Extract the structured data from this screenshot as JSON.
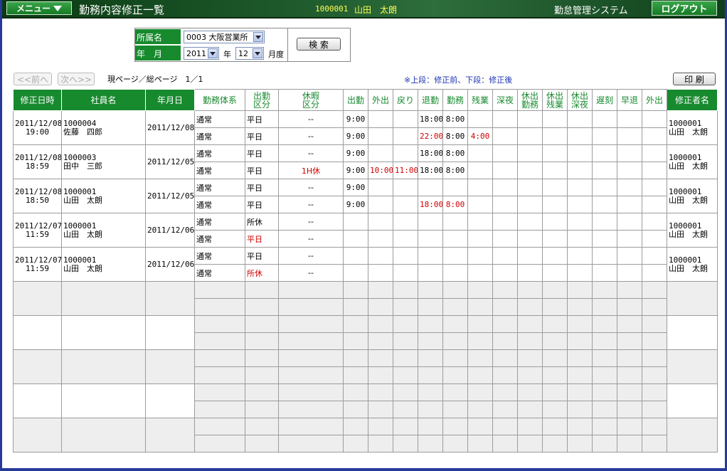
{
  "header": {
    "menu_label": "メニュー",
    "title": "勤務内容修正一覧",
    "user_code": "1000001",
    "user_name": "山田　太朗",
    "system_name": "勤怠管理システム",
    "logout_label": "ログアウト"
  },
  "filter": {
    "dept_label": "所属名",
    "dept_value": "0003 大阪営業所",
    "ym_label": "年　月",
    "year_value": "2011",
    "year_unit": "年",
    "month_value": "12",
    "month_unit": "月度",
    "search_label": "検 索"
  },
  "pager": {
    "prev_label": "<<前へ",
    "next_label": "次へ>>",
    "info": "現ページ／総ページ　1／1"
  },
  "note": "※上段：修正前、下段：修正後",
  "print_label": "印 刷",
  "columns": {
    "mod_dt": "修正日時",
    "emp": "社員名",
    "date": "年月日",
    "system": "勤務体系",
    "att_a": "出勤",
    "att_b": "区分",
    "leave_a": "休暇",
    "leave_b": "区分",
    "in": "出勤",
    "out": "外出",
    "ret": "戻り",
    "leave": "退勤",
    "work": "勤務",
    "ot": "残業",
    "night": "深夜",
    "hw_a": "休出",
    "hw_b": "勤務",
    "ho_a": "休出",
    "ho_b": "残業",
    "hn_a": "休出",
    "hn_b": "深夜",
    "late": "遅刻",
    "early": "早退",
    "goout": "外出",
    "modifier": "修正者名"
  },
  "records": [
    {
      "date_mod": "2011/12/08",
      "time_mod": "19:00",
      "emp_code": "1000004",
      "emp_name": "佐藤　四郎",
      "target_date": "2011/12/08",
      "mod_code": "1000001",
      "mod_name": "山田　太朗",
      "before": {
        "system": "通常",
        "att": "平日",
        "leave": "--",
        "in": "9:00",
        "out": "",
        "ret": "",
        "leave_t": "18:00",
        "work": "8:00",
        "ot": ""
      },
      "after": {
        "system": "通常",
        "att": "平日",
        "leave": "--",
        "in": "9:00",
        "out": "",
        "ret": "",
        "leave_t": "22:00",
        "work": "8:00",
        "ot": "4:00"
      }
    },
    {
      "date_mod": "2011/12/08",
      "time_mod": "18:59",
      "emp_code": "1000003",
      "emp_name": "田中　三郎",
      "target_date": "2011/12/05",
      "mod_code": "1000001",
      "mod_name": "山田　太朗",
      "before": {
        "system": "通常",
        "att": "平日",
        "leave": "--",
        "in": "9:00",
        "out": "",
        "ret": "",
        "leave_t": "18:00",
        "work": "8:00",
        "ot": ""
      },
      "after": {
        "system": "通常",
        "att": "平日",
        "leave": "1H休",
        "in": "9:00",
        "out": "10:00",
        "ret": "11:00",
        "leave_t": "18:00",
        "work": "8:00",
        "ot": ""
      }
    },
    {
      "date_mod": "2011/12/08",
      "time_mod": "18:50",
      "emp_code": "1000001",
      "emp_name": "山田　太朗",
      "target_date": "2011/12/05",
      "mod_code": "1000001",
      "mod_name": "山田　太朗",
      "before": {
        "system": "通常",
        "att": "平日",
        "leave": "--",
        "in": "9:00",
        "out": "",
        "ret": "",
        "leave_t": "",
        "work": "",
        "ot": ""
      },
      "after": {
        "system": "通常",
        "att": "平日",
        "leave": "--",
        "in": "9:00",
        "out": "",
        "ret": "",
        "leave_t": "18:00",
        "work": "8:00",
        "ot": ""
      }
    },
    {
      "date_mod": "2011/12/07",
      "time_mod": "11:59",
      "emp_code": "1000001",
      "emp_name": "山田　太朗",
      "target_date": "2011/12/06",
      "mod_code": "1000001",
      "mod_name": "山田　太朗",
      "before": {
        "system": "通常",
        "att": "所休",
        "leave": "--",
        "in": "",
        "out": "",
        "ret": "",
        "leave_t": "",
        "work": "",
        "ot": ""
      },
      "after": {
        "system": "通常",
        "att": "平日",
        "leave": "--",
        "in": "",
        "out": "",
        "ret": "",
        "leave_t": "",
        "work": "",
        "ot": ""
      }
    },
    {
      "date_mod": "2011/12/07",
      "time_mod": "11:59",
      "emp_code": "1000001",
      "emp_name": "山田　太朗",
      "target_date": "2011/12/06",
      "mod_code": "1000001",
      "mod_name": "山田　太朗",
      "before": {
        "system": "通常",
        "att": "平日",
        "leave": "--",
        "in": "",
        "out": "",
        "ret": "",
        "leave_t": "",
        "work": "",
        "ot": ""
      },
      "after": {
        "system": "通常",
        "att": "所休",
        "leave": "--",
        "in": "",
        "out": "",
        "ret": "",
        "leave_t": "",
        "work": "",
        "ot": ""
      }
    }
  ],
  "colors": {
    "header_green": "#178a2e",
    "changed": "#d00000",
    "note": "#1a33b0",
    "user": "#ffff55"
  }
}
